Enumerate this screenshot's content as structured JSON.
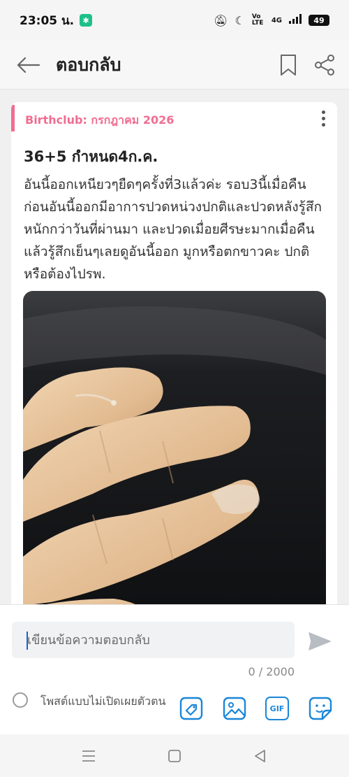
{
  "status_bar": {
    "time": "23:05 น.",
    "network": "4G",
    "volte": "Vo LTE",
    "battery": "49"
  },
  "app_bar": {
    "title": "ตอบกลับ"
  },
  "post": {
    "group_label": "Birthclub: กรกฎาคม 2026",
    "title": "36+5 กำหนด4ก.ค.",
    "body": "อันนี้ออกเหนียวๆยืดๆครั้งที่3แล้วค่ะ รอบ3นี้เมื่อคืนก่อนอันนี้ออกมีอาการปวดหน่วงปกติและปวดหลังรู้สึกหนักกว่าวันที่ผ่านมา และปวดเมื่อยศีรษะมากเมื่อคืน แล้วรู้สึกเย็นๆเลยดูอันนี้ออก มูกหรือตกขาวคะ ปกติหรือต้องไปรพ.",
    "accent_color": "#f06d91"
  },
  "reply": {
    "placeholder": "เขียนข้อความตอบกลับ",
    "char_count": "0 / 2000",
    "anonymous_label": "โพสต์แบบไม่เปิดเผยตัวตน",
    "gif_label": "GIF",
    "tool_color": "#1a86d8"
  }
}
